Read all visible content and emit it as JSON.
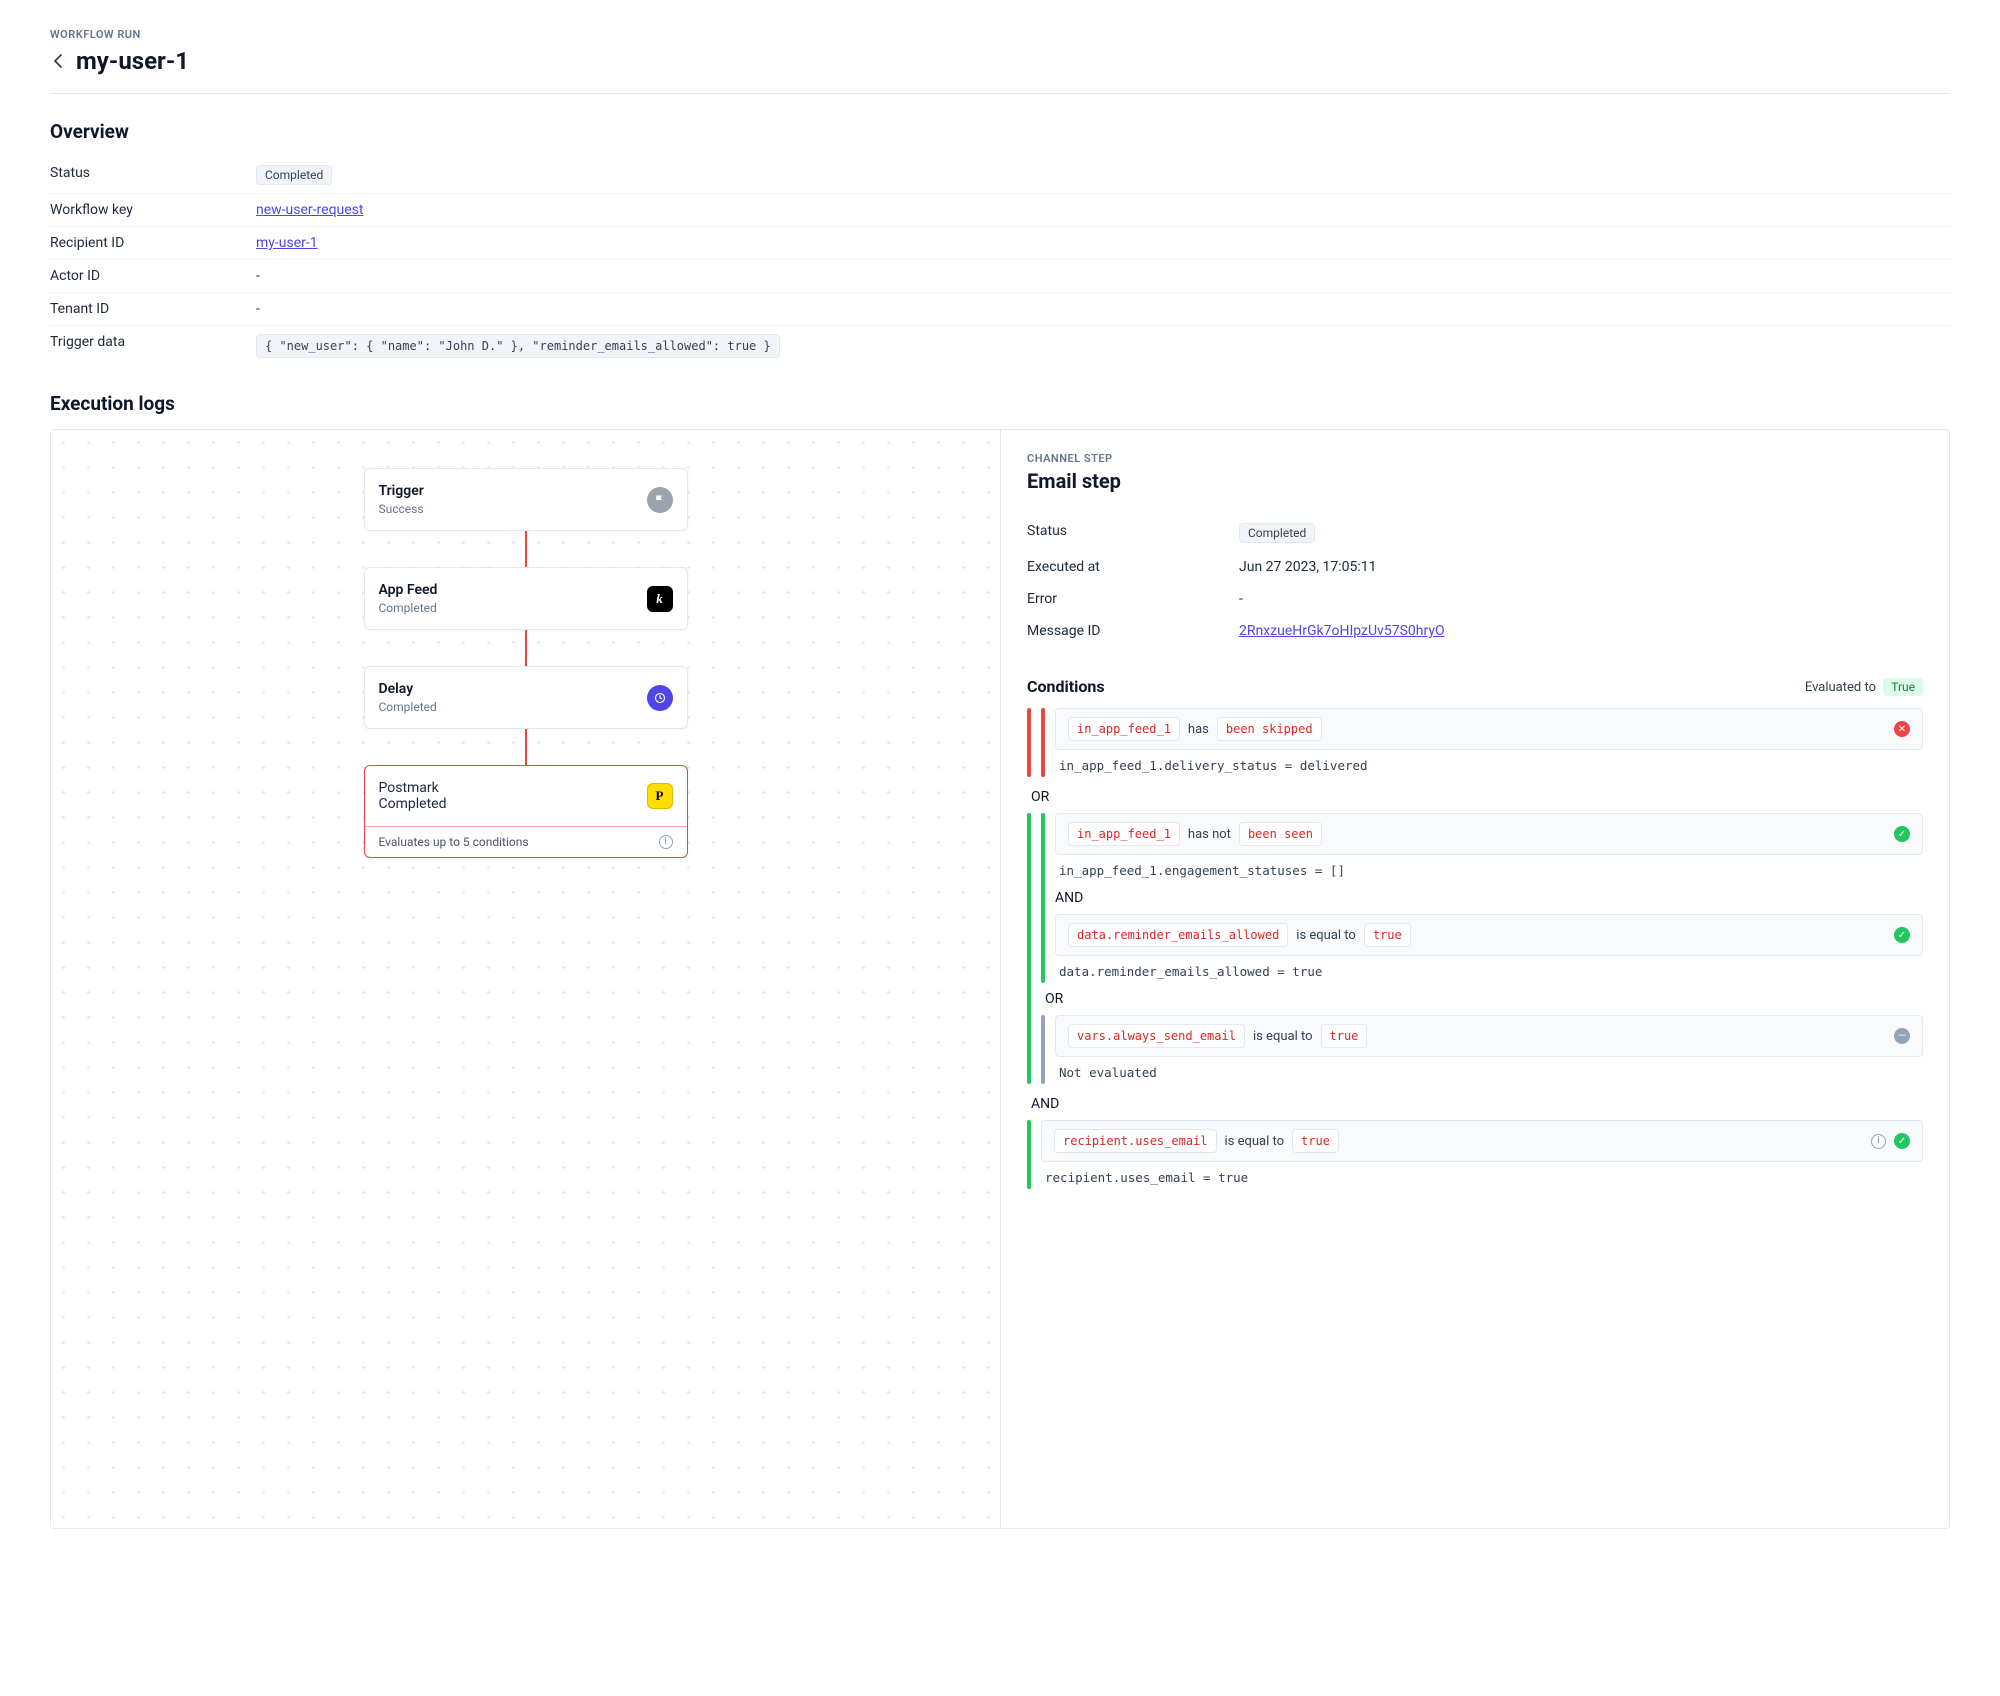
{
  "header": {
    "eyebrow": "WORKFLOW RUN",
    "title": "my-user-1"
  },
  "overview": {
    "heading": "Overview",
    "rows": {
      "status_label": "Status",
      "status_value": "Completed",
      "workflow_key_label": "Workflow key",
      "workflow_key_value": "new-user-request",
      "recipient_label": "Recipient ID",
      "recipient_value": "my-user-1",
      "actor_label": "Actor ID",
      "actor_value": "-",
      "tenant_label": "Tenant ID",
      "tenant_value": "-",
      "trigger_label": "Trigger data",
      "trigger_value": "{ \"new_user\": { \"name\": \"John D.\" }, \"reminder_emails_allowed\": true }"
    }
  },
  "exec": {
    "heading": "Execution logs",
    "nodes": {
      "trigger_title": "Trigger",
      "trigger_sub": "Success",
      "appfeed_title": "App Feed",
      "appfeed_sub": "Completed",
      "delay_title": "Delay",
      "delay_sub": "Completed",
      "postmark_title": "Postmark",
      "postmark_sub": "Completed",
      "postmark_footer": "Evaluates up to 5 conditions"
    }
  },
  "detail": {
    "cs_label": "CHANNEL STEP",
    "title": "Email step",
    "rows": {
      "status_label": "Status",
      "status_value": "Completed",
      "executed_label": "Executed at",
      "executed_value": "Jun 27 2023, 17:05:11",
      "error_label": "Error",
      "error_value": "-",
      "msgid_label": "Message ID",
      "msgid_value": "2RnxzueHrGk7oHIpzUv57S0hryO"
    },
    "conditions": {
      "heading": "Conditions",
      "evaluated_to_label": "Evaluated to",
      "evaluated_to_value": "True",
      "c1": {
        "var": "in_app_feed_1",
        "op": "has",
        "val": "been skipped",
        "detail": "in_app_feed_1.delivery_status = delivered"
      },
      "or1": "OR",
      "c2": {
        "var": "in_app_feed_1",
        "op": "has not",
        "val": "been seen",
        "detail": "in_app_feed_1.engagement_statuses = []"
      },
      "and1": "AND",
      "c3": {
        "var": "data.reminder_emails_allowed",
        "op": "is equal to",
        "val": "true",
        "detail": "data.reminder_emails_allowed = true"
      },
      "or2": "OR",
      "c4": {
        "var": "vars.always_send_email",
        "op": "is equal to",
        "val": "true",
        "detail": "Not evaluated"
      },
      "and2": "AND",
      "c5": {
        "var": "recipient.uses_email",
        "op": "is equal to",
        "val": "true",
        "detail": "recipient.uses_email = true"
      }
    }
  },
  "icons": {
    "appfeed_letter": "k",
    "postmark_letter": "P"
  }
}
